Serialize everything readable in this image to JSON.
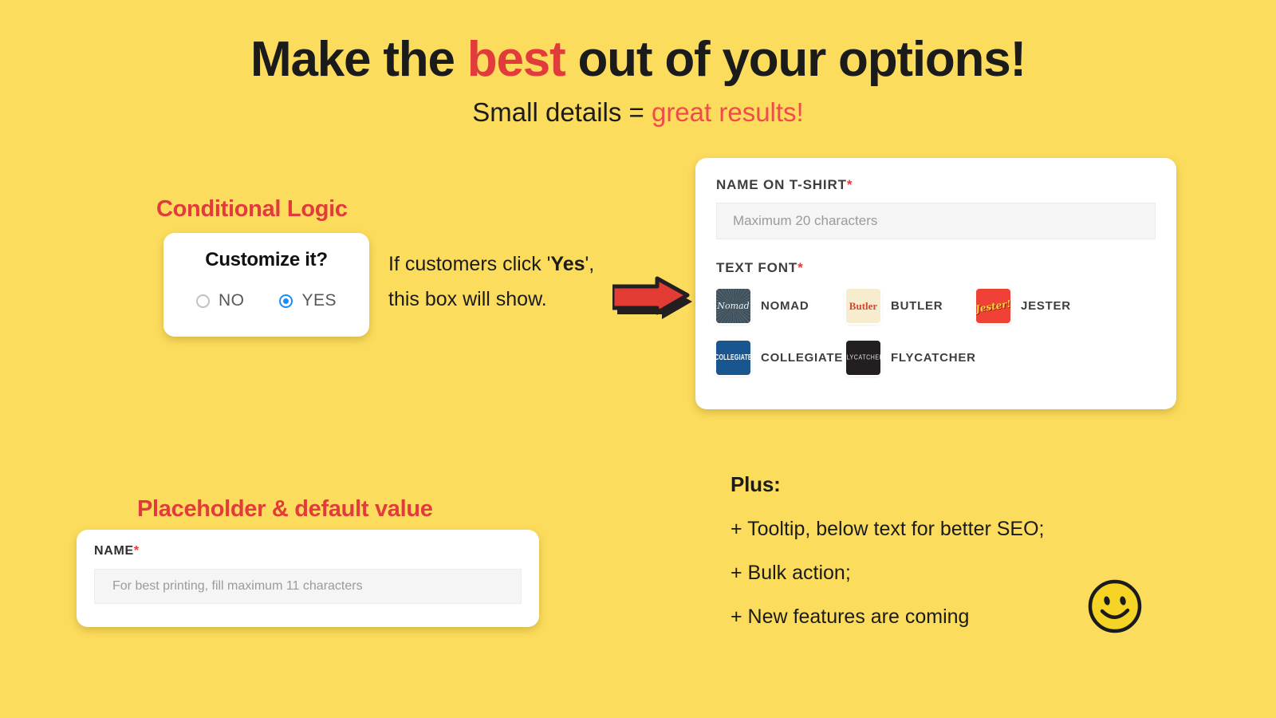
{
  "headline": {
    "part1": "Make the ",
    "accent": "best",
    "part2": " out of your options!"
  },
  "subhead": {
    "part1": "Small details = ",
    "accent": "great results!"
  },
  "captions": {
    "conditional_logic": "Conditional Logic",
    "placeholder_default": "Placeholder & default value"
  },
  "radio_card": {
    "title": "Customize it?",
    "options": [
      {
        "label": "NO",
        "selected": false
      },
      {
        "label": "YES",
        "selected": true
      }
    ]
  },
  "explain": {
    "line1_a": "If customers click '",
    "line1_bold": "Yes",
    "line1_b": "',",
    "line2": "this box will show."
  },
  "form_card": {
    "name_label": "NAME ON T-SHIRT",
    "name_required_mark": "*",
    "name_placeholder": "Maximum 20 characters",
    "font_label": "TEXT FONT",
    "font_required_mark": "*",
    "fonts": [
      {
        "name": "NOMAD",
        "swatch_text": "Nomad",
        "swatch_bg": "#3e505b",
        "swatch_fg": "#eef2f3"
      },
      {
        "name": "BUTLER",
        "swatch_text": "Butler",
        "swatch_bg": "#f8ecce",
        "swatch_fg": "#d0482f"
      },
      {
        "name": "JESTER",
        "swatch_text": "Jester!",
        "swatch_bg": "#ef4136",
        "swatch_fg": "#fbd53a"
      },
      {
        "name": "COLLEGIATE",
        "swatch_text": "COLLEGIATE",
        "swatch_bg": "#19558f",
        "swatch_fg": "#ffffff"
      },
      {
        "name": "FLYCATCHER",
        "swatch_text": "FLYCATCHER",
        "swatch_bg": "#231f20",
        "swatch_fg": "#e9e9e9"
      }
    ]
  },
  "placeholder_card": {
    "label": "NAME",
    "required_mark": "*",
    "placeholder": "For best printing, fill maximum 11 characters"
  },
  "plus_block": {
    "title": "Plus:",
    "items": [
      "+ Tooltip, below text for better SEO;",
      "+ Bulk action;",
      "+ New features are coming"
    ]
  },
  "icons": {
    "arrow": "arrow-right-icon",
    "smiley": "smiley-face-icon"
  },
  "colors": {
    "background": "#fcdc5c",
    "accent_red": "#e23b3b",
    "required_red": "#e8373a",
    "radio_blue": "#1a8cff",
    "ink": "#1b1b1b",
    "card_white": "#ffffff",
    "input_grey": "#f5f5f5",
    "smiley_yellow": "#f5d426"
  }
}
